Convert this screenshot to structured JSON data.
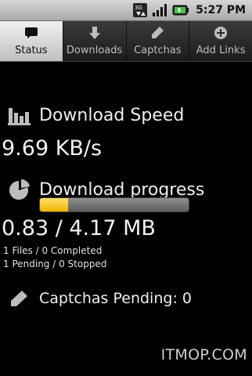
{
  "statusbar": {
    "time": "5:27 PM",
    "network_icon": "3g-icon",
    "signal_icon": "signal-icon",
    "battery_icon": "battery-icon"
  },
  "tabs": [
    {
      "label": "Status",
      "icon": "status-icon",
      "active": true
    },
    {
      "label": "Downloads",
      "icon": "download-arrow-icon",
      "active": false
    },
    {
      "label": "Captchas",
      "icon": "pencil-icon",
      "active": false
    },
    {
      "label": "Add Links",
      "icon": "plus-circle-icon",
      "active": false
    }
  ],
  "status": {
    "speed_label": "Download Speed",
    "speed_value": "9.69 KB/s",
    "progress_label": "Download progress",
    "progress_fraction": 0.19,
    "progress_value": "0.83 / 4.17 MB",
    "files_line": "1 Files / 0 Completed",
    "pending_line": "1 Pending / 0 Stopped",
    "captchas_label": "Captchas Pending: 0"
  },
  "watermark": "ITMOP.COM",
  "colors": {
    "accent": "#f5c000",
    "background": "#000000",
    "active_tab": "#e0e0e0"
  }
}
